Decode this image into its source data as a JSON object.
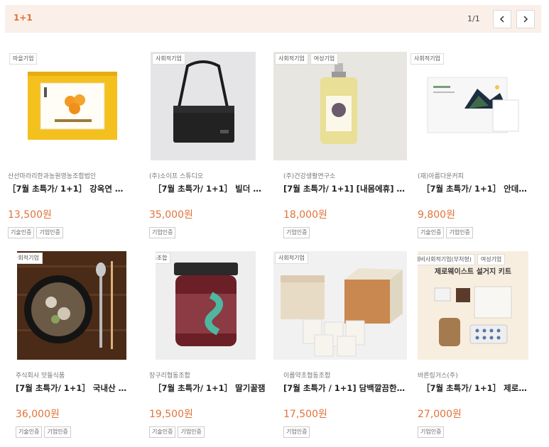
{
  "header": {
    "section_label": "1+1",
    "pagination": "1/1"
  },
  "colors": {
    "accent": "#e0733a",
    "header_bg": "#fbf0e9"
  },
  "products": [
    {
      "badges": [
        "마을기업"
      ],
      "company": "산선마라리한과농원영농조합법인",
      "title": "［7월 초특가/ 1+1］ 강옥연 …",
      "price": "13,500원",
      "tags": [
        "기술인증",
        "기업인증"
      ],
      "image": "yellow-gift-box"
    },
    {
      "badges": [
        "사회적기업"
      ],
      "company": "(주)소이프 스튜디오",
      "title": "［7월 초특가/ 1+1］ 빌더 플…",
      "price": "35,000원",
      "tags": [
        "기업인증"
      ],
      "image": "black-crossbody-bag"
    },
    {
      "badges": [
        "사회적기업",
        "여성기업"
      ],
      "company": "(주)건강생활연구소",
      "title": "[7월 초특가/ 1+1] [내몸에휴] …",
      "price": "18,000원",
      "tags": [
        "기업인증"
      ],
      "image": "oil-bottle"
    },
    {
      "badges": [
        "사회적기업"
      ],
      "company": "(재)아름다운커피",
      "title": "［7월 초특가/ 1+1］ 안데스…",
      "price": "9,800원",
      "tags": [
        "기술인증",
        "기업인증"
      ],
      "image": "drip-coffee-box"
    },
    {
      "badges": [
        "사회적기업"
      ],
      "company": "주식회사 맛들식품",
      "title": "[7월 초특가/ 1+1］ 국내산 …",
      "price": "36,000원",
      "tags": [
        "기술인증",
        "기업인증"
      ],
      "image": "soup-bowl"
    },
    {
      "badges": [
        "협동조합"
      ],
      "company": "장구리협동조합",
      "title": "［7월 초특가/ 1+1］ 딸기꿀잼",
      "price": "19,500원",
      "tags": [
        "기술인증",
        "기업인증"
      ],
      "image": "jam-jar"
    },
    {
      "badges": [
        "사회적기업"
      ],
      "company": "이롭약초협동조합",
      "title": "[7월 초특가 / 1+1] 담백깔끔한…",
      "price": "17,500원",
      "tags": [
        "기업인증"
      ],
      "image": "tea-boxes"
    },
    {
      "badges": [
        "예비사회적기업(부처형)",
        "여성기업"
      ],
      "company": "바른링거스(주)",
      "title": "［7월 초특가/ 1+1］ 제로웨…",
      "price": "27,000원",
      "tags": [
        "기업인증"
      ],
      "image": "zero-waste-kit",
      "image_caption": "제로웨이스트 설거지 키트"
    }
  ]
}
